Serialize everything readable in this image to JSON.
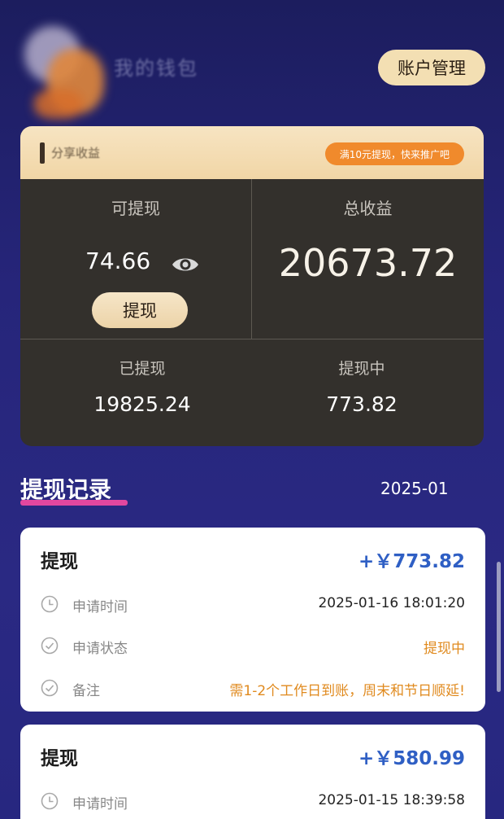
{
  "header": {
    "title": "我的钱包",
    "account_button": "账户管理"
  },
  "card": {
    "title": "分享收益",
    "promo": "满10元提现，快来推广吧",
    "withdrawable_label": "可提现",
    "withdrawable_value": "74.66",
    "withdraw_button": "提现",
    "total_label": "总收益",
    "total_value": "20673.72",
    "withdrawn_label": "已提现",
    "withdrawn_value": "19825.24",
    "pending_label": "提现中",
    "pending_value": "773.82"
  },
  "records_section": {
    "title": "提现记录",
    "month": "2025-01"
  },
  "records": [
    {
      "title": "提现",
      "amount": "+￥773.82",
      "time_label": "申请时间",
      "time_value": "2025-01-16 18:01:20",
      "status_label": "申请状态",
      "status_value": "提现中",
      "note_label": "备注",
      "note_value": "需1-2个工作日到账，周末和节日顺延!"
    },
    {
      "title": "提现",
      "amount": "+￥580.99",
      "time_label": "申请时间",
      "time_value": "2025-01-15 18:39:58"
    }
  ],
  "colors": {
    "accent_gold": "#f3dfb3",
    "amount_blue": "#2f5fc4",
    "status_orange": "#e08a1e",
    "underline_pink": "#e2479f"
  },
  "icons": {
    "eye": "eye-icon",
    "clock": "clock-icon",
    "check_circle": "check-circle-icon"
  }
}
